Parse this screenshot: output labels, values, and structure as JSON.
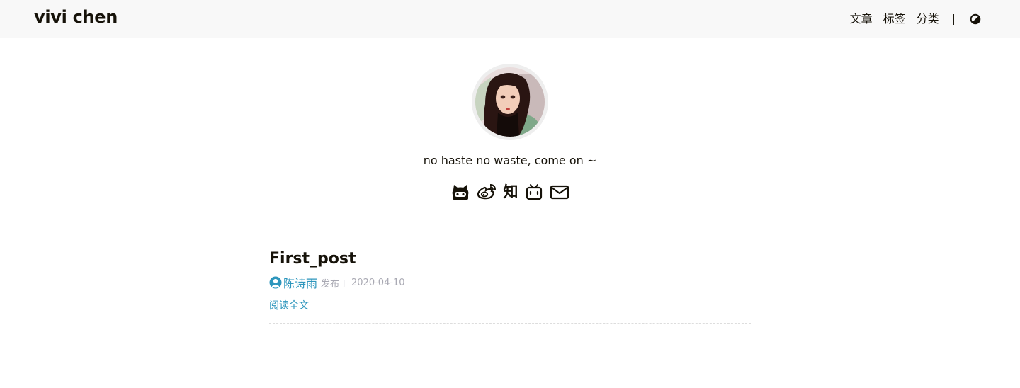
{
  "header": {
    "brand": "vivi chen",
    "nav": [
      {
        "label": "文章"
      },
      {
        "label": "标签"
      },
      {
        "label": "分类"
      }
    ],
    "separator": "|",
    "theme_toggle_icon": "contrast-half-circle-icon"
  },
  "intro": {
    "avatar_icon": "avatar-portrait",
    "tagline": "no haste no waste, come on ~",
    "social": [
      {
        "name": "github",
        "icon": "github-icon"
      },
      {
        "name": "weibo",
        "icon": "weibo-icon"
      },
      {
        "name": "zhihu",
        "glyph": "知",
        "icon": "zhihu-icon"
      },
      {
        "name": "bilibili",
        "icon": "bilibili-icon"
      },
      {
        "name": "email",
        "icon": "email-icon"
      }
    ]
  },
  "posts": [
    {
      "title": "First_post",
      "author": "陈诗雨",
      "published_label": "发布于",
      "date": "2020-04-10",
      "read_more": "阅读全文"
    }
  ],
  "colors": {
    "text": "#161209",
    "accent": "#2d96bd",
    "meta": "#a9a9b3",
    "navbar_bg": "#f8f8f8"
  }
}
